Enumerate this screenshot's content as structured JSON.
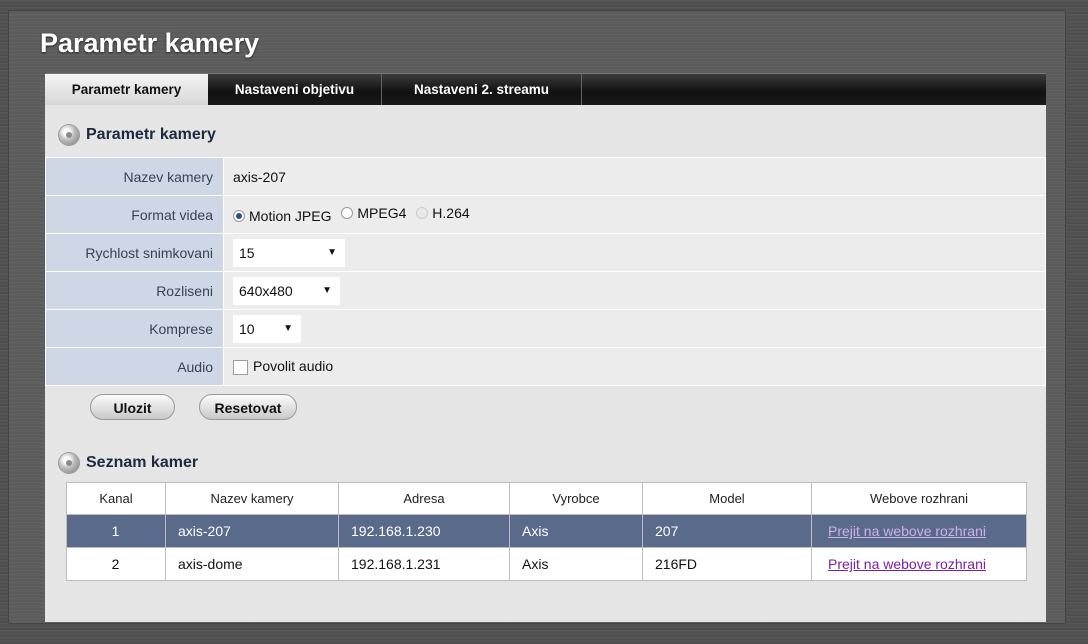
{
  "page_title": "Parametr kamery",
  "tabs": [
    {
      "label": "Parametr kamery",
      "active": true
    },
    {
      "label": "Nastaveni objetivu",
      "active": false
    },
    {
      "label": "Nastaveni 2. streamu",
      "active": false
    }
  ],
  "camera_params": {
    "section_title": "Parametr kamery",
    "name_label": "Nazev kamery",
    "name_value": "axis-207",
    "format_label": "Format videa",
    "format_options": [
      "Motion JPEG",
      "MPEG4",
      "H.264"
    ],
    "format_selected": "Motion JPEG",
    "fps_label": "Rychlost snimkovani",
    "fps_value": "15",
    "resolution_label": "Rozliseni",
    "resolution_value": "640x480",
    "compression_label": "Komprese",
    "compression_value": "10",
    "audio_label": "Audio",
    "audio_checkbox_label": "Povolit audio",
    "audio_enabled": false
  },
  "buttons": {
    "save": "Ulozit",
    "reset": "Resetovat"
  },
  "camera_list": {
    "section_title": "Seznam kamer",
    "headers": [
      "Kanal",
      "Nazev kamery",
      "Adresa",
      "Vyrobce",
      "Model",
      "Webove rozhrani"
    ],
    "rows": [
      {
        "channel": "1",
        "name": "axis-207",
        "address": "192.168.1.230",
        "vendor": "Axis",
        "model": "207",
        "web": "Prejit na webove rozhrani",
        "selected": true
      },
      {
        "channel": "2",
        "name": "axis-dome",
        "address": "192.168.1.231",
        "vendor": "Axis",
        "model": "216FD",
        "web": "Prejit na webove rozhrani",
        "selected": false
      }
    ]
  },
  "colors": {
    "label_cell": "#cfd6e5",
    "selected_row": "#5a6a8a",
    "link": "#7a1fa2"
  }
}
